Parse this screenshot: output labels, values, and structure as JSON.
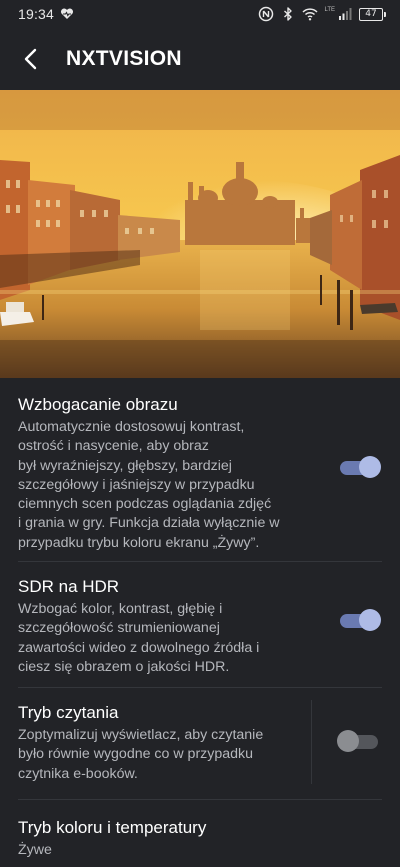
{
  "status_bar": {
    "time": "19:34",
    "network_type": "LTE",
    "battery_level": "47",
    "icons": [
      "heart-monitor-icon",
      "nfc-icon",
      "bluetooth-icon",
      "wifi-icon",
      "signal-icon",
      "battery-icon"
    ]
  },
  "app_bar": {
    "title": "NXTVISION",
    "back_icon": "arrow-back-icon"
  },
  "hero_image": {
    "subject": "Venice Grand Canal at sunset"
  },
  "settings": [
    {
      "title": "Wzbogacanie obrazu",
      "lines": [
        "Automatycznie dostosowuj kontrast,",
        "ostrość i nasycenie, aby obraz",
        "był wyraźniejszy, głębszy, bardziej",
        "szczegółowy i jaśniejszy w przypadku",
        "ciemnych scen podczas oglądania zdjęć",
        "i grania w gry. Funkcja działa wyłącznie w",
        "przypadku trybu koloru ekranu „Żywy”."
      ],
      "toggle_on": true
    },
    {
      "title": "SDR na HDR",
      "lines": [
        "Wzbogać kolor, kontrast, głębię i",
        "szczegółowość strumieniowanej",
        "zawartości wideo z dowolnego źródła i",
        "ciesz się obrazem o jakości HDR."
      ],
      "toggle_on": true
    },
    {
      "title": "Tryb czytania",
      "lines": [
        "Zoptymalizuj wyświetlacz, aby czytanie",
        "było równie wygodne co w przypadku",
        "czytnika e-booków."
      ],
      "toggle_on": false
    },
    {
      "title": "Tryb koloru i temperatury",
      "value": "Żywe"
    }
  ],
  "colors": {
    "background": "#222327",
    "toggle_on_track": "#6a7ab1",
    "toggle_on_knob": "#aebbe6",
    "toggle_off_track": "#54565b",
    "toggle_off_knob": "#8b8d91",
    "secondary_text": "#b5b7bc"
  }
}
